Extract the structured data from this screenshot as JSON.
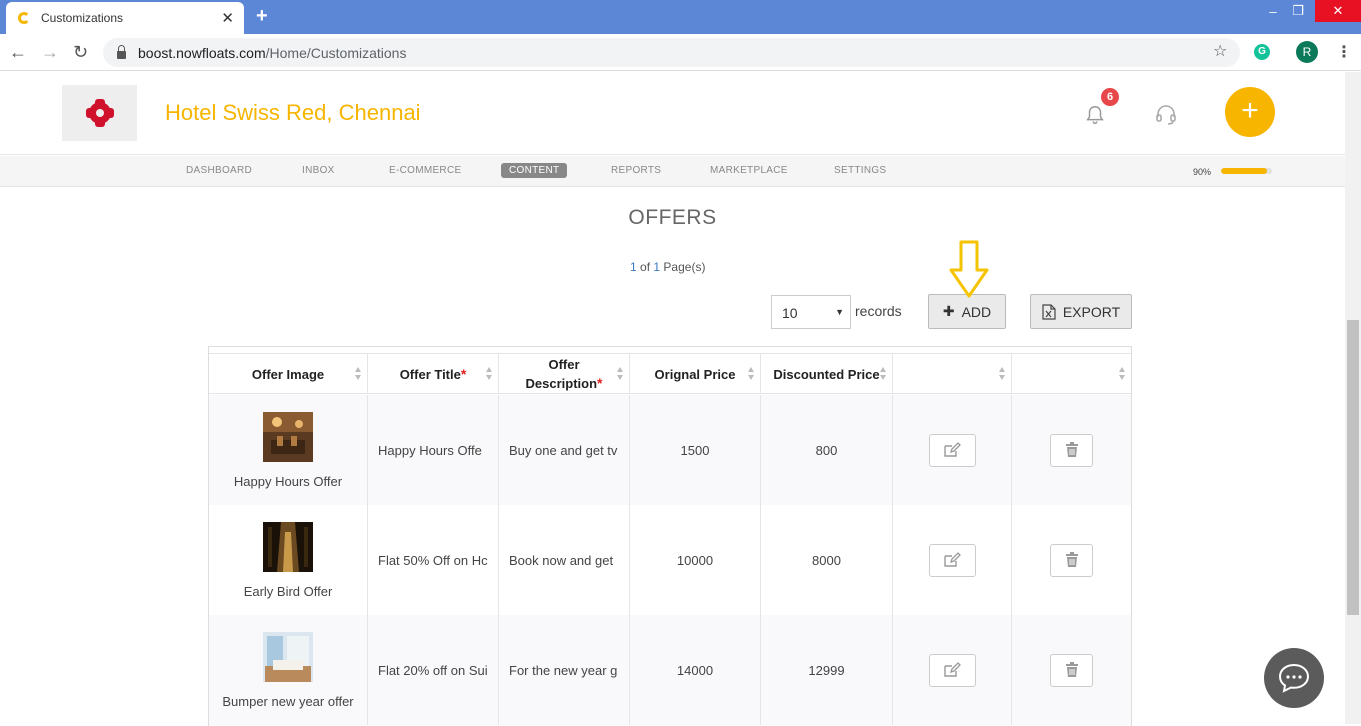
{
  "browser": {
    "tab_title": "Customizations",
    "url_host": "boost.nowfloats.com",
    "url_path": "/Home/Customizations",
    "profile_initial": "R",
    "grammarly": "G"
  },
  "header": {
    "brand": "Hotel Swiss Red, Chennai",
    "notification_count": "6",
    "fab_label": "+"
  },
  "nav": {
    "items": [
      "DASHBOARD",
      "INBOX",
      "E-COMMERCE",
      "CONTENT",
      "REPORTS",
      "MARKETPLACE",
      "SETTINGS"
    ],
    "active": "CONTENT",
    "progress_label": "90%",
    "progress_value": 0.9
  },
  "page": {
    "title": "OFFERS",
    "pager_current": "1",
    "pager_of": "of",
    "pager_total": "1",
    "pager_suffix": "Page(s)",
    "records_select": "10",
    "records_label": "records",
    "add_label": "ADD",
    "export_label": "EXPORT"
  },
  "table": {
    "headers": {
      "image": "Offer Image",
      "title": "Offer Title",
      "desc_line1": "Offer",
      "desc_line2": "Description",
      "orig": "Orignal Price",
      "disc": "Discounted Price"
    },
    "rows": [
      {
        "image_caption": "Happy Hours Offer",
        "title": "Happy Hours Offe",
        "description": "Buy one and get tv",
        "original": "1500",
        "discounted": "800"
      },
      {
        "image_caption": "Early Bird Offer",
        "title": "Flat 50% Off on Hc",
        "description": "Book now and get",
        "original": "10000",
        "discounted": "8000"
      },
      {
        "image_caption": "Bumper new year offer",
        "title": "Flat 20% off on Sui",
        "description": "For the new year g",
        "original": "14000",
        "discounted": "12999"
      }
    ]
  },
  "colors": {
    "accent": "#f7b500",
    "chrome_blue": "#5b87d6",
    "logo_red": "#d0112b"
  }
}
